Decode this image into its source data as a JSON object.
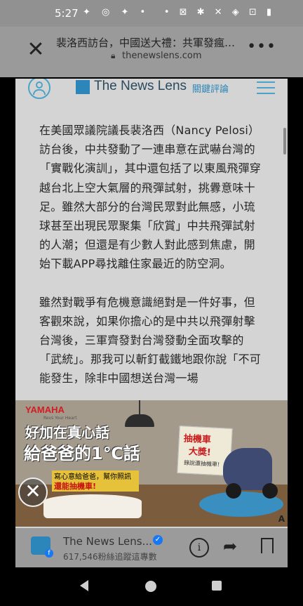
{
  "status_bar": {
    "time": "5:27",
    "left_icons": "✦ ◎ ✦ •",
    "right_icons": "• ⊠ ✱ ✕ ◈ ⊡ ▮"
  },
  "custom_tab": {
    "title": "裴洛西訪台，中國送大禮：共軍發瘋似的...",
    "url": "thenewslens.com"
  },
  "site_header": {
    "logo_text": "The News Lens",
    "logo_sub": "關鍵評論"
  },
  "article": {
    "paragraphs": [
      "在美國眾議院議長裴洛西（Nancy Pelosi）訪台後，中共發動了一連串意在武嚇台灣的「實戰化演訓」，其中還包括了以東風飛彈穿越台北上空大氣層的飛彈試射，挑釁意味十足。雖然大部分的台灣民眾對此無感，小琉球甚至出現民眾聚集「欣賞」中共飛彈試射的人潮；但還是有少數人對此感到焦慮，開始下載APP尋找離住家最近的防空洞。",
      "雖然對戰爭有危機意識絕對是一件好事，但客觀來說，如果你擔心的是中共以飛彈射擊台灣後，三軍齊發對台灣發動全面攻擊的「武統」。那我可以斬釘截鐵地跟你說「不可能發生，除非中國想送台灣一場"
    ]
  },
  "ad": {
    "brand": "YAMAHA",
    "brand_sub": "Revs Your Heart",
    "headline1": "好加在真心話",
    "headline2": "給爸爸的1℃話",
    "line1": "寫心意給爸爸，幫你照訊寄出",
    "line2": "還能抽機車!",
    "sign_line1": "抽機車",
    "sign_line2": "大獎!",
    "sign_line3": "錄說還抽機車!",
    "badge": "A"
  },
  "bottom_bar": {
    "name": "The News Lens...",
    "stats": "617,546粉絲追蹤這專數"
  }
}
